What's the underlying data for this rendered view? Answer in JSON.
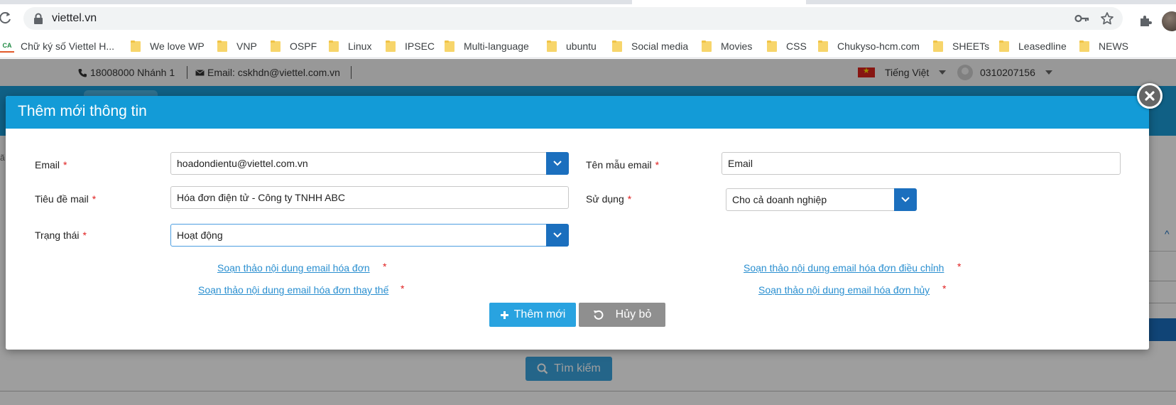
{
  "browser": {
    "url": "viettel.vn",
    "bookmarks": [
      {
        "label": "Chữ ký số Viettel H...",
        "icon": "ca-logo-icon"
      },
      {
        "label": "We love WP",
        "icon": "folder-icon"
      },
      {
        "label": "VNP",
        "icon": "folder-icon"
      },
      {
        "label": "OSPF",
        "icon": "folder-icon"
      },
      {
        "label": "Linux",
        "icon": "folder-icon"
      },
      {
        "label": "IPSEC",
        "icon": "folder-icon"
      },
      {
        "label": "Multi-language",
        "icon": "folder-icon"
      },
      {
        "label": "ubuntu",
        "icon": "folder-icon"
      },
      {
        "label": "Social media",
        "icon": "folder-icon"
      },
      {
        "label": "Movies",
        "icon": "folder-icon"
      },
      {
        "label": "CSS",
        "icon": "folder-icon"
      },
      {
        "label": "Chukyso-hcm.com",
        "icon": "folder-icon"
      },
      {
        "label": "SHEETs",
        "icon": "folder-icon"
      },
      {
        "label": "Leasedline",
        "icon": "folder-icon"
      },
      {
        "label": "NEWS",
        "icon": "folder-icon"
      }
    ]
  },
  "topbar": {
    "phone": "18008000 Nhánh 1",
    "email": "Email: cskhdn@viettel.com.vn",
    "language": "Tiếng Việt",
    "account": "0310207156"
  },
  "background": {
    "search_label": "Tìm kiếm"
  },
  "modal": {
    "title": "Thêm mới thông tin",
    "fields": {
      "email": {
        "label": "Email",
        "value": "hoadondientu@viettel.com.vn"
      },
      "template_name": {
        "label": "Tên mẫu email",
        "value": "Email"
      },
      "subject": {
        "label": "Tiêu đề mail",
        "value": "Hóa đơn điện tử - Công ty TNHH ABC"
      },
      "usage": {
        "label": "Sử dụng",
        "value": "Cho cả doanh nghiệp"
      },
      "status": {
        "label": "Trạng thái",
        "value": "Hoạt động"
      }
    },
    "required_mark": "*",
    "links": {
      "invoice": "Soạn thảo nội dung email hóa đơn",
      "adjust": "Soạn thảo nội dung email hóa đơn điều chỉnh",
      "replace": "Soạn thảo nội dung email hóa đơn thay thế",
      "cancel": "Soạn thảo nội dung email hóa đơn hủy"
    },
    "buttons": {
      "add": "Thêm mới",
      "cancel": "Hủy bỏ"
    }
  },
  "colors": {
    "modal_header": "#139bd7",
    "dropdown_button": "#1b6fbe",
    "primary_button": "#29a3e0",
    "cancel_button": "#8f8f8f",
    "link": "#2a8fd0",
    "required": "#e02020"
  }
}
